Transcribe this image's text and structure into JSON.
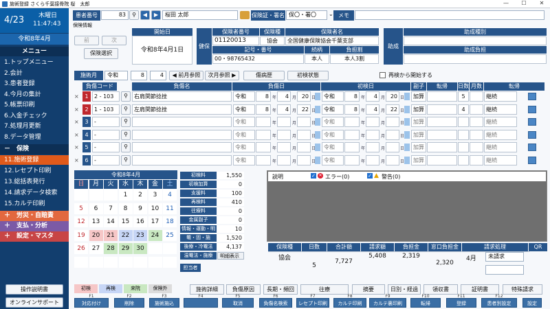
{
  "window": {
    "title": "施術登録 さくら千葉接骨院 桜　太郎"
  },
  "sidebar": {
    "date": "4/23",
    "weekday": "木曜日",
    "time": "11:47:43",
    "era_month": "令和8年4月",
    "menu_header": "メニュー",
    "items": [
      "1.トップメニュー",
      "2.会計",
      "3.患者登録",
      "4.今月の集計",
      "5.帳票印刷",
      "6.入金チェック",
      "7.処理月更新",
      "8.データ管理"
    ],
    "insurance_header": "－　保険",
    "ins_items": [
      "11.施術登録",
      "12.レセプト印刷",
      "13.総括表発行",
      "14.請求データ検索",
      "15.カルテ印刷"
    ],
    "sections": [
      "＋　労災・自賠責",
      "＋　支払・分析",
      "＋　設定・マスタ"
    ],
    "btn_manual": "操作説明書",
    "btn_support": "オンラインサポート"
  },
  "header": {
    "patient_no_label": "患者番号",
    "patient_no": "83",
    "patient_name": "桜田 太郎",
    "insurance_label": "保険証・署名",
    "insurance_value": "保〇・署〇",
    "memo_label": "メモ",
    "memo": ""
  },
  "ins": {
    "section": "保険情報",
    "prev": "前",
    "next": "次",
    "select": "保険選択",
    "start_label": "開始日",
    "start_date": "令和8年4月1日",
    "kenpo": "健保",
    "h_insurer_no": "保険者番号",
    "h_type": "保険種",
    "h_insurer_name": "保険者名",
    "insurer_no": "01120013",
    "type": "協会",
    "insurer_name": "全国健康保険協会千葉支部",
    "h_symbol": "記号・番号",
    "h_relation": "続柄",
    "h_burden": "負担割",
    "symbol": "00・98765432",
    "relation": "本人",
    "burden": "本人3割",
    "josei": "助成",
    "h_josei_type": "助成種別",
    "h_josei_burden": "助成負担"
  },
  "month": {
    "label": "施術月",
    "era": "令和",
    "year": "8",
    "month": "4",
    "prev": "前月参照",
    "next": "次月参照",
    "history": "傷病歴",
    "first": "初検状態",
    "restart": "再検から開始する"
  },
  "injury": {
    "headers": [
      "負傷コード",
      "負傷名",
      "負傷日",
      "初検日",
      "副子",
      "転帰",
      "日数",
      "月数",
      "転帰"
    ],
    "rows": [
      {
        "no": "1",
        "code": "2",
        "code2": "103",
        "name": "右肩関節捻挫",
        "era": "令和",
        "y": "8",
        "m": "4",
        "d": "20",
        "f_era": "令和",
        "fy": "8",
        "fm": "4",
        "fd": "20",
        "fuku": "加算",
        "days": "5",
        "tenki": "継続"
      },
      {
        "no": "2",
        "code": "1",
        "code2": "103",
        "name": "左肩関節捻挫",
        "era": "令和",
        "y": "8",
        "m": "4",
        "d": "22",
        "f_era": "令和",
        "fy": "8",
        "fm": "4",
        "fd": "22",
        "fuku": "加算",
        "days": "4",
        "tenki": "継続"
      },
      {
        "no": "3",
        "code": "-",
        "code2": "",
        "name": "",
        "era": "令和",
        "y": "",
        "m": "",
        "d": "",
        "f_era": "令和",
        "fy": "",
        "fm": "",
        "fd": "",
        "fuku": "加算",
        "days": "",
        "tenki": "継続"
      },
      {
        "no": "4",
        "code": "-",
        "code2": "",
        "name": "",
        "era": "令和",
        "y": "",
        "m": "",
        "d": "",
        "f_era": "令和",
        "fy": "",
        "fm": "",
        "fd": "",
        "fuku": "加算",
        "days": "",
        "tenki": "継続"
      },
      {
        "no": "5",
        "code": "-",
        "code2": "",
        "name": "",
        "era": "令和",
        "y": "",
        "m": "",
        "d": "",
        "f_era": "令和",
        "fy": "",
        "fm": "",
        "fd": "",
        "fuku": "加算",
        "days": "",
        "tenki": "継続"
      },
      {
        "no": "6",
        "code": "-",
        "code2": "",
        "name": "",
        "era": "令和",
        "y": "",
        "m": "",
        "d": "",
        "f_era": "令和",
        "fy": "",
        "fm": "",
        "fd": "",
        "fuku": "加算",
        "days": "",
        "tenki": "継続"
      }
    ],
    "unit_y": "年",
    "unit_m": "月",
    "unit_d": "日"
  },
  "calendar": {
    "title": "令和8年4月",
    "weekdays": [
      "日",
      "月",
      "火",
      "水",
      "木",
      "金",
      "土"
    ],
    "legend": [
      "初検",
      "再検",
      "来院",
      "保険外"
    ]
  },
  "amounts": {
    "rows": [
      [
        "初検料",
        "1,550"
      ],
      [
        "初検加算",
        "0"
      ],
      [
        "支援料",
        "100"
      ],
      [
        "再検料",
        "410"
      ],
      [
        "往療料",
        "0"
      ],
      [
        "金属副子",
        "0"
      ],
      [
        "情報・運動・明細",
        "10"
      ],
      [
        "罨・固・施",
        "1,520"
      ],
      [
        "後療・冷罨法",
        "4,137"
      ],
      [
        "温罨法・施療",
        "明細表示"
      ]
    ],
    "tantou": "担当者"
  },
  "msg": {
    "label": "説明",
    "error": "エラー(0)",
    "warn": "警告(0)"
  },
  "summary": {
    "headers": [
      "保険種",
      "日数",
      "合計額",
      "請求額",
      "負担金",
      "窓口負担金",
      "請求処理",
      "QR"
    ],
    "type": "協会",
    "days": "5",
    "total": "7,727",
    "claim": "5,408",
    "burden": "2,319",
    "window": "2,320",
    "proc_month": "4月",
    "proc_status": "未請求"
  },
  "tabs": [
    "施術詳細",
    "負傷原因",
    "長期・頻回",
    "往療",
    "摘要",
    "日別・経過",
    "領収書",
    "証明書",
    "特殊請求"
  ],
  "fkeys": [
    [
      "F1",
      "対応付け"
    ],
    [
      "F2",
      "削除"
    ],
    [
      "F3",
      "施術施込"
    ],
    [
      "F4",
      ""
    ],
    [
      "F5",
      "取消"
    ],
    [
      "F6",
      "負傷名検索"
    ],
    [
      "F7",
      "レセプト印刷"
    ],
    [
      "F8",
      "カルテ印刷"
    ],
    [
      "F9",
      "カルテ裏印刷"
    ],
    [
      "F10",
      "転帰"
    ],
    [
      "F11",
      "登録"
    ],
    [
      "F12",
      "患者別設定"
    ],
    [
      "",
      "設定"
    ]
  ],
  "colors": {
    "accent": "#26548a",
    "sidebar": "#123e6e",
    "active": "#e05a1b",
    "rousai": "#e2683f",
    "shiharai": "#7b5aa6",
    "settei": "#c84545"
  }
}
